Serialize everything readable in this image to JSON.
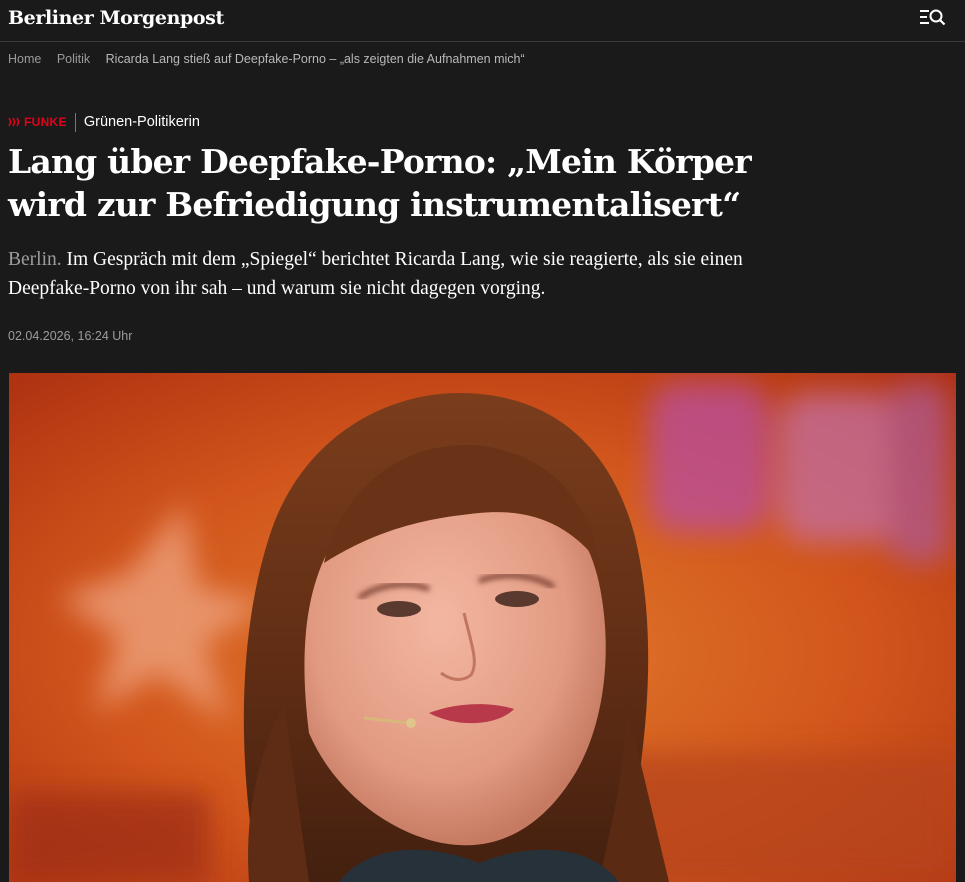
{
  "header": {
    "logo_text": "Berliner Morgenpost",
    "menu_icon": "menu-search-icon"
  },
  "breadcrumb": {
    "items": [
      "Home",
      "Politik"
    ],
    "current": "Ricarda Lang stieß auf Deepfake-Porno – „als zeigten die Aufnahmen mich“"
  },
  "article": {
    "brand_label": "FUNKE",
    "topic": "Grünen-Politikerin",
    "headline": "Lang über Deepfake-Porno: „Mein Körper wird zur Befriedigung instrumentalisert“",
    "dateline": "Berlin.",
    "teaser": "Im Gespräch mit dem „Spiegel“ berichtet Ricarda Lang, wie sie reagierte, als sie einen Deepfake-Porno von ihr sah – und warum sie nicht dagegen vorging.",
    "timestamp": "02.04.2026, 16:24 Uhr"
  },
  "colors": {
    "page_background": "#1a1a1a",
    "brand_red": "#e2001a",
    "muted_text": "#9c9c9c",
    "text": "#ffffff"
  }
}
